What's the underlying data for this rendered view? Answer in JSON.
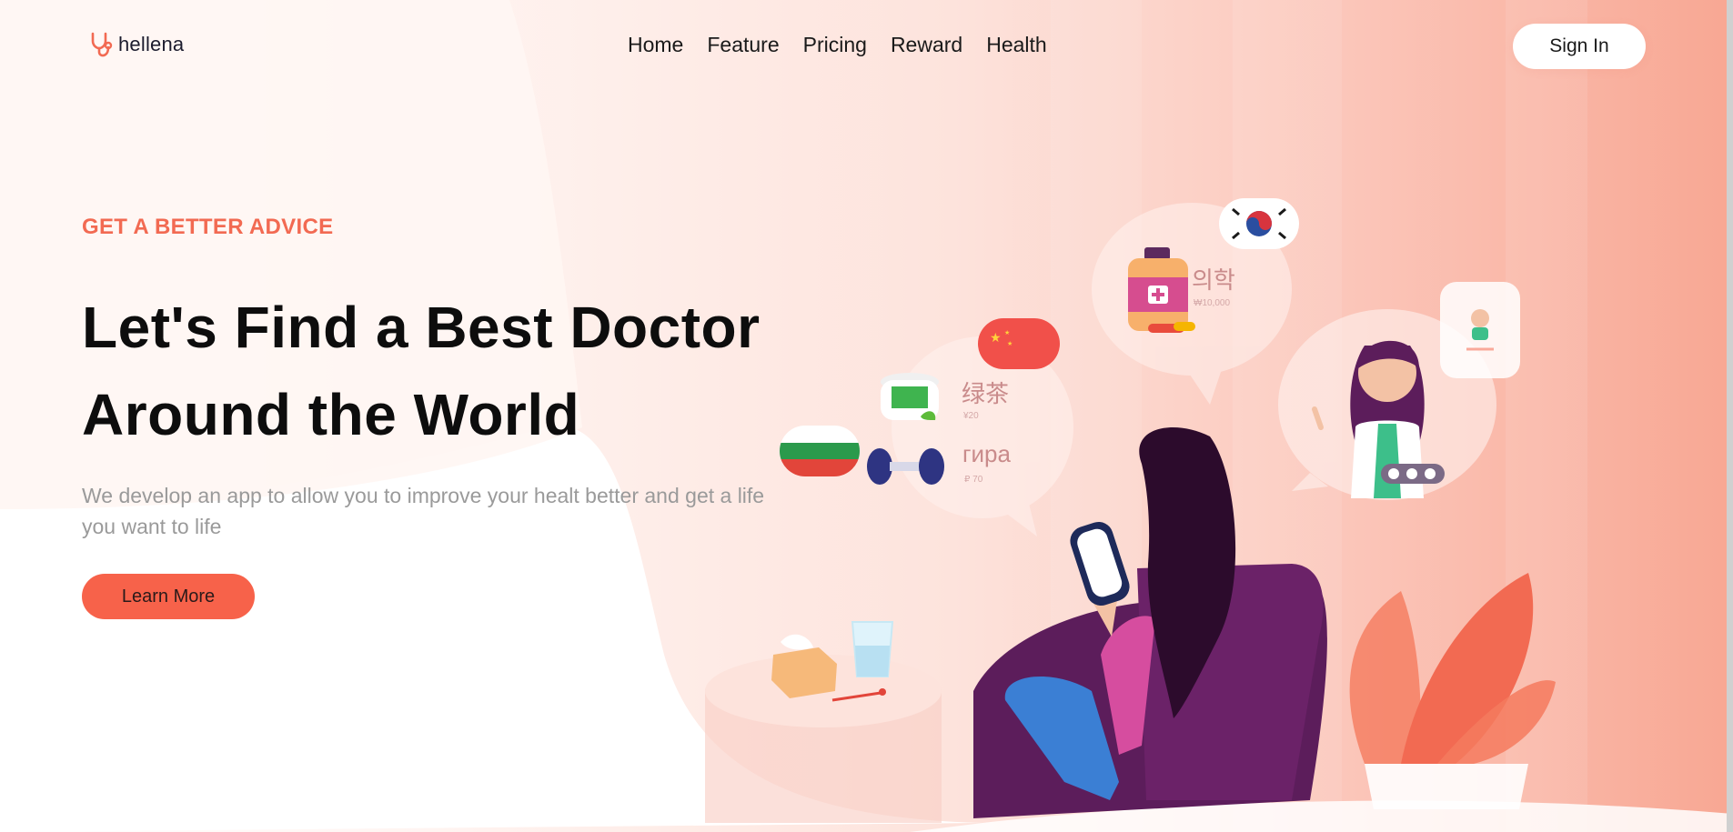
{
  "brand": {
    "name": "hellena",
    "icon": "stethoscope-icon",
    "accent": "#f26a52"
  },
  "nav": {
    "items": [
      "Home",
      "Feature",
      "Pricing",
      "Reward",
      "Health"
    ]
  },
  "header": {
    "signin_label": "Sign In"
  },
  "hero": {
    "eyebrow": "GET A BETTER ADVICE",
    "title_line1": "Let's Find a Best Doctor",
    "title_line2": "Around the World",
    "subtitle": "We develop an app to allow you to improve your healt better and get a life you want to life",
    "cta_label": "Learn More"
  },
  "illustration": {
    "bubble_korean": {
      "label": "의학",
      "small": "₩10,000"
    },
    "bubble_chinese": {
      "label": "绿茶",
      "small": "¥20"
    },
    "bubble_russian": {
      "label": "гира",
      "small": "₽ 70"
    }
  },
  "colors": {
    "cta": "#f7624a",
    "heading": "#0d0d0d",
    "muted": "#9a9a9a"
  }
}
